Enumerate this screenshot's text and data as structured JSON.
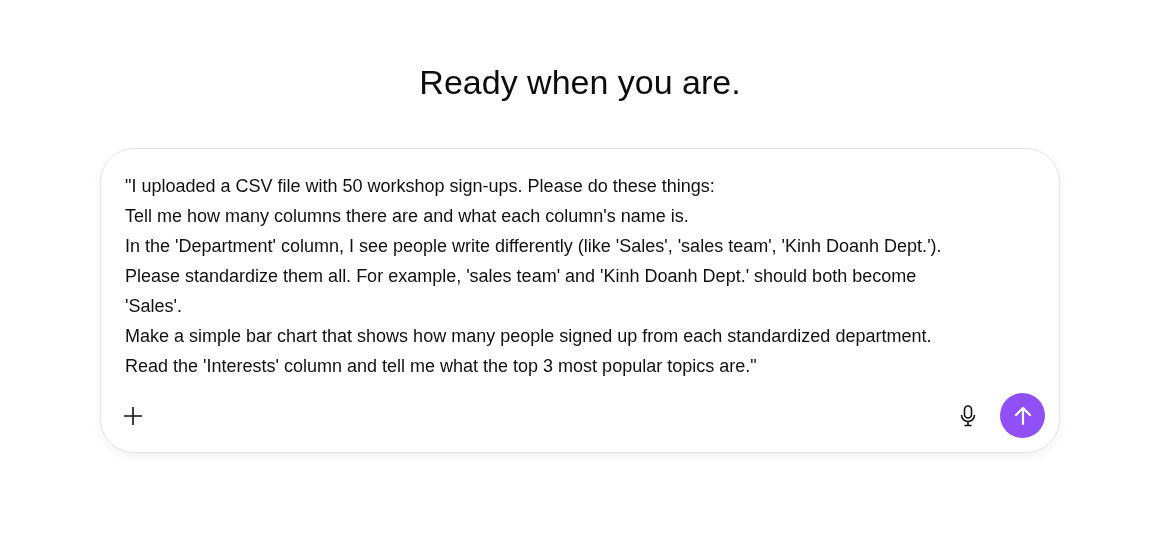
{
  "heading": "Ready when you are.",
  "composer": {
    "value": "\"I uploaded a CSV file with 50 workshop sign-ups. Please do these things:\nTell me how many columns there are and what each column's name is.\nIn the 'Department' column, I see people write differently (like 'Sales', 'sales team', 'Kinh Doanh Dept.').\nPlease standardize them all. For example, 'sales team' and 'Kinh Doanh Dept.' should both become\n'Sales'.\nMake a simple bar chart that shows how many people signed up from each standardized department.\nRead the 'Interests' column and tell me what the top 3 most popular topics are.\""
  }
}
